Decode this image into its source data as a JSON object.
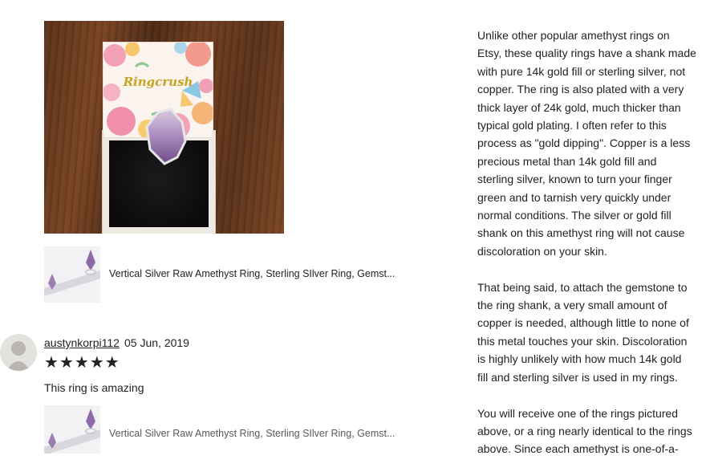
{
  "product_photo": {
    "alt": "Amethyst ring in gift box",
    "box_brand_text": "Ringcrush"
  },
  "purchased_item_1": {
    "title": "Vertical Silver Raw Amethyst Ring, Sterling SIlver Ring, Gemst..."
  },
  "review": {
    "reviewer_name": "austynkorpi112",
    "date": "05 Jun, 2019",
    "rating": 5,
    "stars": [
      "★",
      "★",
      "★",
      "★",
      "★"
    ],
    "text": "This ring is amazing"
  },
  "purchased_item_2": {
    "title": "Vertical Silver Raw Amethyst Ring, Sterling SIlver Ring, Gemst..."
  },
  "description": {
    "paragraph1": [
      "Unlike other popular amethyst rings on",
      "Etsy, these quality rings have a shank made",
      "with pure 14k gold fill or sterling silver, not",
      "copper. The ring is also plated with a very",
      "thick layer of 24k gold, much thicker than",
      "typical gold plating. I often refer to this",
      "process as \"gold dipping\". Copper is a less",
      "precious metal than 14k gold fill and",
      "sterling silver, known to turn your finger",
      "green and to tarnish very quickly under",
      "normal conditions. The silver or gold fill",
      "shank on this amethyst ring will not cause",
      "discoloration on your skin."
    ],
    "paragraph2": [
      "That being said, to attach the gemstone to",
      "the ring shank, a very small amount of",
      "copper is needed, although little to none of",
      "this metal touches your skin. Discoloration",
      "is highly unlikely with how much 14k gold",
      "fill and sterling silver is used in my rings."
    ],
    "paragraph3": [
      "You will receive one of the rings pictured",
      "above, or a ring nearly identical to the rings",
      "above. Since each amethyst is one-of-a-"
    ]
  },
  "colors": {
    "text": "#222222",
    "muted_text": "#595959",
    "amethyst": "#9b7bb0",
    "background": "#ffffff"
  }
}
